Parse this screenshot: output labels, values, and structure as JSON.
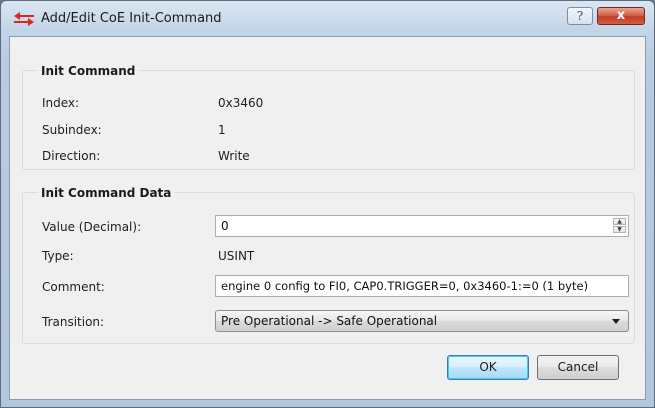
{
  "window": {
    "title": "Add/Edit CoE Init-Command",
    "help_glyph": "?",
    "close_glyph": "x"
  },
  "init_command": {
    "group_title": "Init Command",
    "index_label": "Index:",
    "index_value": "0x3460",
    "subindex_label": "Subindex:",
    "subindex_value": "1",
    "direction_label": "Direction:",
    "direction_value": "Write"
  },
  "init_command_data": {
    "group_title": "Init Command Data",
    "value_label": "Value (Decimal):",
    "value_field": "0",
    "type_label": "Type:",
    "type_value": "USINT",
    "comment_label": "Comment:",
    "comment_field": "engine 0 config to FI0, CAP0.TRIGGER=0, 0x3460-1:=0 (1 byte)",
    "transition_label": "Transition:",
    "transition_selected": "Pre Operational -> Safe Operational"
  },
  "buttons": {
    "ok_label": "OK",
    "cancel_label": "Cancel"
  },
  "icons": {
    "app": "double-arrow-icon",
    "spin_up": "spin-up-arrow-icon",
    "spin_down": "spin-down-arrow-icon",
    "dropdown": "chevron-down-icon"
  },
  "colors": {
    "close_button": "#c8432b",
    "ok_button_border": "#3c7fb1",
    "app_icon_red": "#d9281c"
  }
}
